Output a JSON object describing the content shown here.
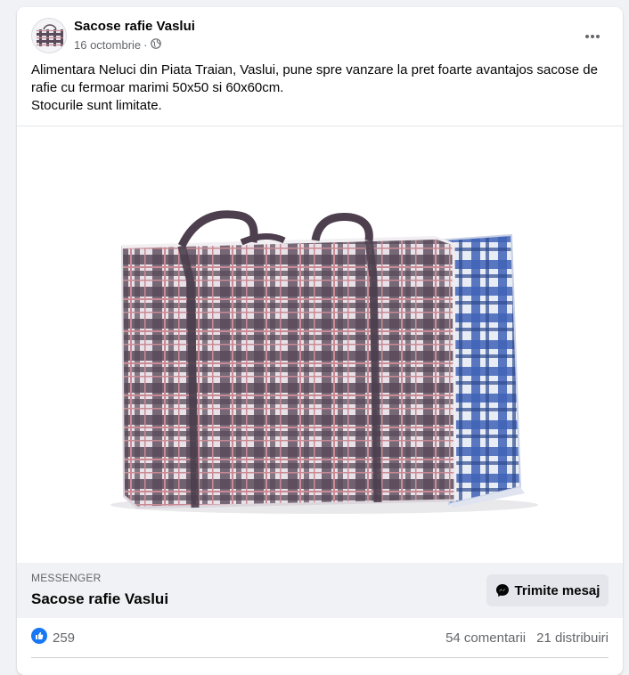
{
  "post": {
    "page_name": "Sacose rafie Vaslui",
    "date": "16 octombrie",
    "separator": "·",
    "privacy_icon": "globe-icon",
    "more_icon": "ellipsis-icon",
    "text_lines": [
      "Alimentara Neluci din Piata Traian, Vaslui, pune spre vanzare la pret foarte avantajos sacose de rafie cu fermoar marimi 50x50 si 60x60cm.",
      "Stocurile sunt limitate."
    ]
  },
  "image": {
    "subject": "product-photo-plaid-raffia-bags",
    "front_bag_colors": [
      "#5a4a5a",
      "#e8e2e8",
      "#c98a94"
    ],
    "back_bag_colors": [
      "#3f63b8",
      "#e8ecf5"
    ]
  },
  "cta": {
    "label": "MESSENGER",
    "title": "Sacose rafie Vaslui",
    "button_label": "Trimite mesaj",
    "button_icon": "messenger-icon"
  },
  "stats": {
    "like_icon": "like-icon",
    "likes": "259",
    "comments": "54 comentarii",
    "shares": "21 distribuiri"
  },
  "colors": {
    "like_blue": "#1877f2",
    "background": "#f0f2f5",
    "card": "#ffffff",
    "text_primary": "#050505",
    "text_secondary": "#65676b"
  }
}
